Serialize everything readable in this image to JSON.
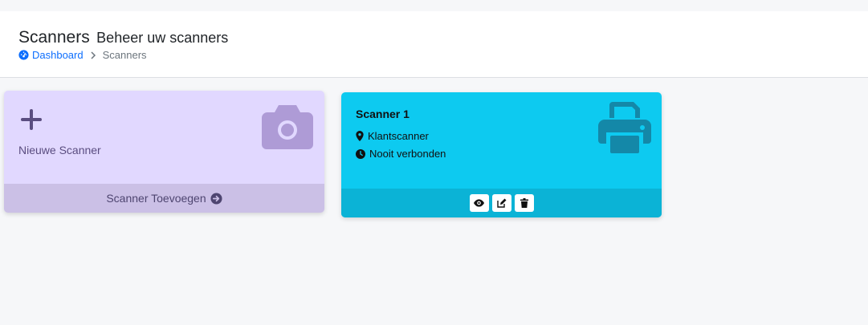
{
  "header": {
    "title": "Scanners",
    "subtitle": "Beheer uw scanners",
    "breadcrumb": {
      "home_label": "Dashboard",
      "current_label": "Scanners"
    }
  },
  "add_card": {
    "label": "Nieuwe Scanner",
    "footer_label": "Scanner Toevoegen",
    "icon": "camera-icon",
    "color": "#e1d8ff"
  },
  "scanners": [
    {
      "name": "Scanner 1",
      "location": "Klantscanner",
      "status": "Nooit verbonden",
      "icon": "printer-icon",
      "color": "#0dcaf0",
      "actions": [
        "view-icon",
        "edit-icon",
        "delete-icon"
      ]
    }
  ]
}
